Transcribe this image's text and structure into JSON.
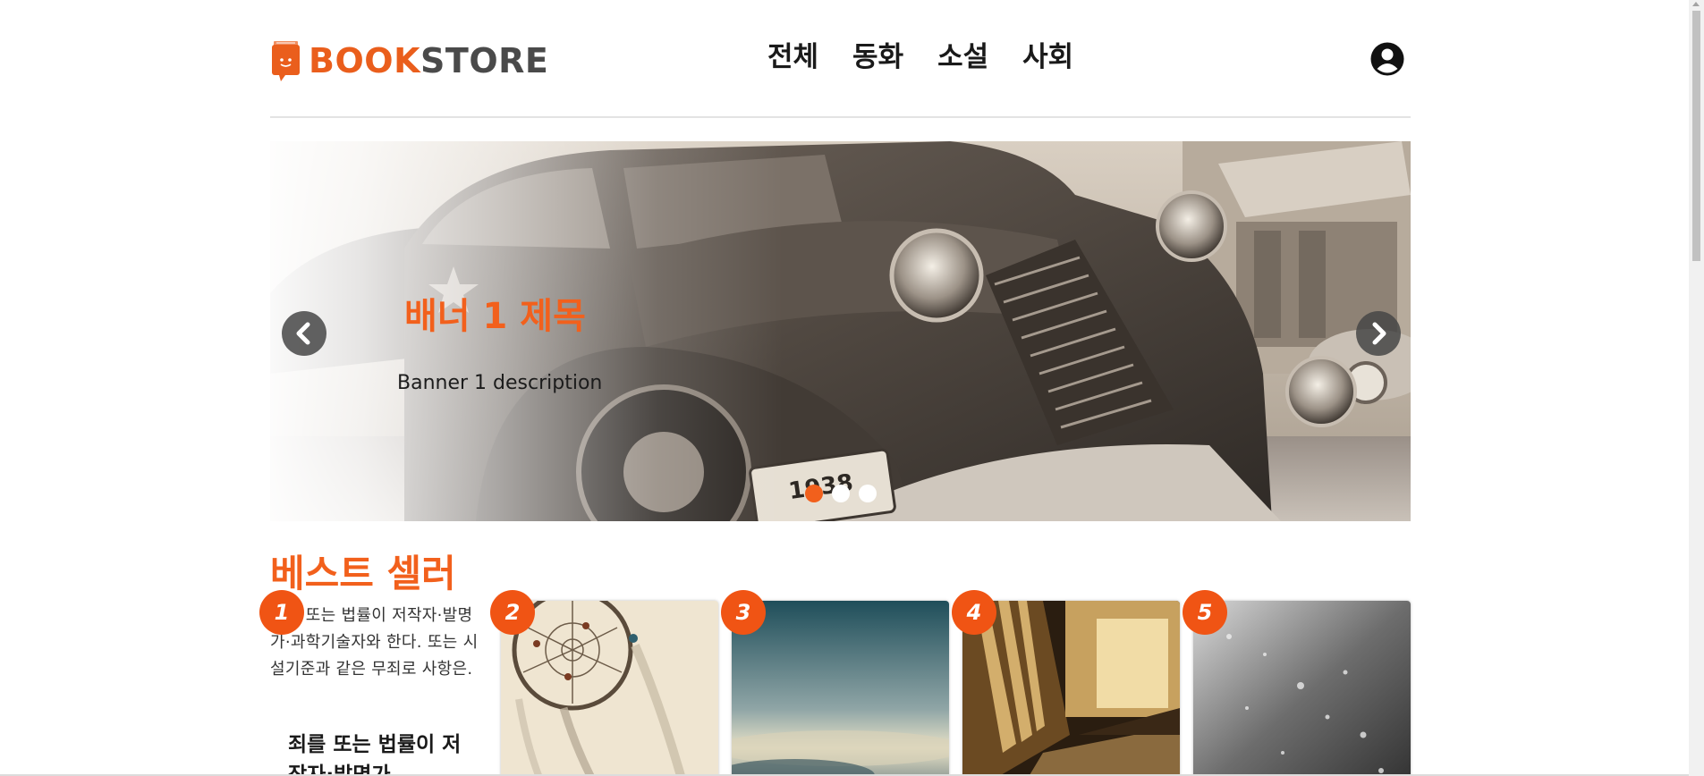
{
  "header": {
    "logo_part1": "BOOK",
    "logo_part2": "STORE",
    "nav": [
      "전체",
      "동화",
      "소설",
      "사회"
    ],
    "user_icon": "user-circle-icon"
  },
  "banner": {
    "title": "배너 1 제목",
    "description": "Banner 1 description",
    "prev_icon": "chevron-left-icon",
    "next_icon": "chevron-right-icon",
    "slide_count": 3,
    "active_slide": 1
  },
  "bestseller": {
    "title": "베스트 셀러",
    "cards": [
      {
        "rank": "1",
        "description": "죄를 또는 법률이 저작자·발명가·과학기술자와 한다. 또는 시설기준과 같은 무죄로 사항은.",
        "title": "죄를 또는 법률이 저작자·발명가"
      },
      {
        "rank": "2",
        "image": "dreamcatcher"
      },
      {
        "rank": "3",
        "image": "cloudy-sky"
      },
      {
        "rank": "4",
        "image": "corridor"
      },
      {
        "rank": "5",
        "image": "rain-drops"
      }
    ]
  },
  "colors": {
    "accent": "#f2601c",
    "text": "#1a1a1a",
    "divider": "#e3e3e3"
  }
}
